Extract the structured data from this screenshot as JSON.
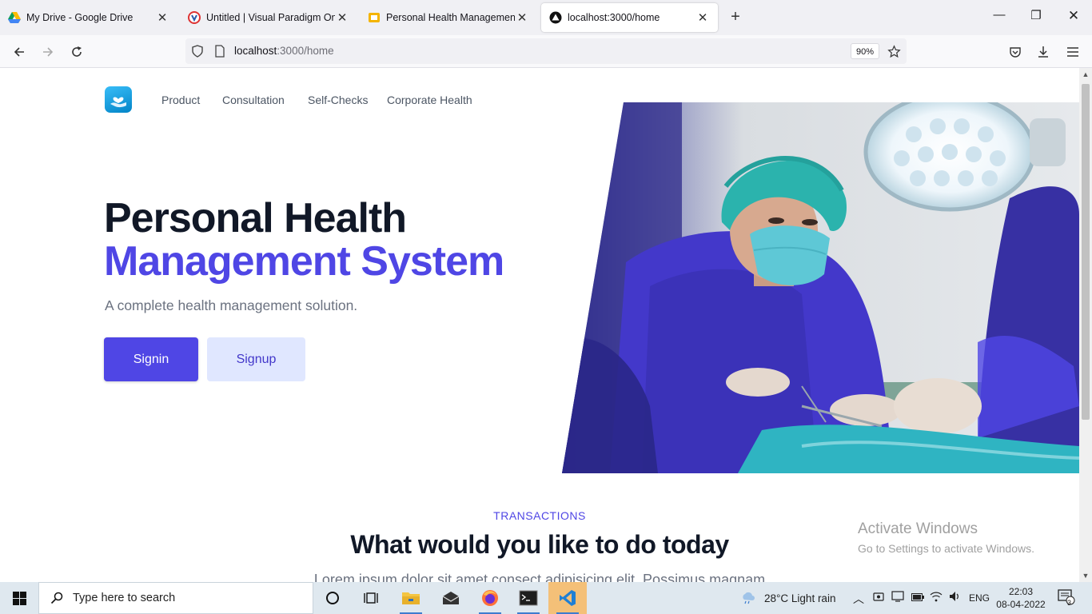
{
  "browser": {
    "tabs": [
      {
        "title": "My Drive - Google Drive",
        "icon": "google-drive-icon",
        "active": false
      },
      {
        "title": "Untitled | Visual Paradigm Online",
        "icon": "visual-paradigm-icon",
        "active": false
      },
      {
        "title": "Personal Health Management System",
        "icon": "slides-icon",
        "active": false
      },
      {
        "title": "localhost:3000/home",
        "icon": "app-icon",
        "active": true
      }
    ],
    "url_host": "localhost",
    "url_path": ":3000/home",
    "zoom": "90%"
  },
  "site": {
    "nav": [
      "Product",
      "Consultation",
      "Self-Checks",
      "Corporate Health"
    ],
    "hero": {
      "title_line1": "Personal Health",
      "title_line2": "Management System",
      "subtitle": "A complete health management solution.",
      "signin_label": "Signin",
      "signup_label": "Signup",
      "image_alt": "Surgeon in scrubs, cap and mask under operating lights"
    },
    "section": {
      "eyebrow": "TRANSACTIONS",
      "title": "What would you like to do today",
      "description": "Lorem ipsum dolor sit amet consect adipisicing elit. Possimus magnam"
    },
    "colors": {
      "primary": "#4f46e5",
      "primary_light": "#e0e7ff",
      "heading": "#111827"
    }
  },
  "watermark": {
    "line1": "Activate Windows",
    "line2": "Go to Settings to activate Windows."
  },
  "taskbar": {
    "search_placeholder": "Type here to search",
    "weather": "28°C  Light rain",
    "language": "ENG",
    "time": "22:03",
    "date": "08-04-2022",
    "notification_count": "3"
  }
}
